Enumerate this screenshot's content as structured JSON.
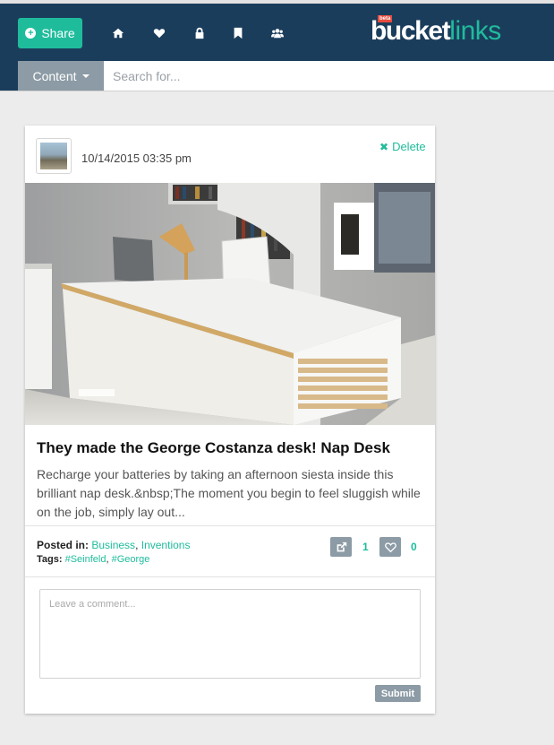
{
  "header": {
    "share_label": "Share",
    "brand_beta": "beta",
    "brand_bucket": "bucket",
    "brand_links": "links",
    "nav_icons": [
      "home-icon",
      "heart-icon",
      "lock-icon",
      "bookmark-icon",
      "users-icon"
    ]
  },
  "search": {
    "dropdown_label": "Content",
    "placeholder": "Search for..."
  },
  "post": {
    "date": "10/14/2015 03:35 pm",
    "delete_label": "Delete",
    "title": "They made the George Costanza desk! Nap Desk",
    "excerpt": "Recharge your batteries by taking an afternoon siesta inside this brilliant nap desk.&nbsp;The moment you begin to feel sluggish while on the job, simply lay out...",
    "posted_in_label": "Posted in:",
    "categories": [
      "Business",
      "Inventions"
    ],
    "category_separator": ",",
    "tags_label": "Tags:",
    "tags": [
      "#Seinfeld",
      "#George"
    ],
    "tag_separator": ",",
    "share_count": "1",
    "like_count": "0"
  },
  "comment": {
    "placeholder": "Leave a comment...",
    "submit_label": "Submit"
  },
  "colors": {
    "navbar": "#1b3d5c",
    "accent": "#1fbc9c",
    "muted_button": "#8c9ba5",
    "background": "#ececec"
  }
}
